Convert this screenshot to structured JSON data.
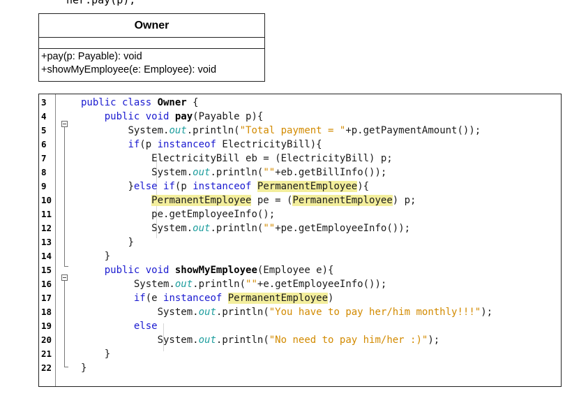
{
  "top_fragment": "ner.pay(p);",
  "uml": {
    "class_name": "Owner",
    "operations": [
      "+pay(p: Payable): void",
      "+showMyEmployee(e: Employee): void"
    ]
  },
  "code": {
    "lines": [
      {
        "num": "3",
        "indent": 2,
        "tokens": [
          {
            "t": "public class ",
            "c": "kw"
          },
          {
            "t": "Owner",
            "c": "b"
          },
          {
            "t": " {"
          }
        ]
      },
      {
        "num": "4",
        "indent": 6,
        "tokens": [
          {
            "t": "public void ",
            "c": "kw"
          },
          {
            "t": "pay",
            "c": "b"
          },
          {
            "t": "(Payable p){"
          }
        ]
      },
      {
        "num": "5",
        "indent": 10,
        "tokens": [
          {
            "t": "System."
          },
          {
            "t": "out",
            "c": "it"
          },
          {
            "t": ".println("
          },
          {
            "t": "\"Total payment = \"",
            "c": "st"
          },
          {
            "t": "+p.getPaymentAmount());"
          }
        ]
      },
      {
        "num": "6",
        "indent": 10,
        "tokens": [
          {
            "t": "if",
            "c": "kw"
          },
          {
            "t": "(p "
          },
          {
            "t": "instanceof",
            "c": "kw"
          },
          {
            "t": " ElectricityBill){"
          }
        ]
      },
      {
        "num": "7",
        "indent": 14,
        "tokens": [
          {
            "t": "ElectricityBill eb = (ElectricityBill) p;"
          }
        ]
      },
      {
        "num": "8",
        "indent": 14,
        "tokens": [
          {
            "t": "System."
          },
          {
            "t": "out",
            "c": "it"
          },
          {
            "t": ".println("
          },
          {
            "t": "\"\"",
            "c": "st"
          },
          {
            "t": "+eb.getBillInfo());"
          }
        ]
      },
      {
        "num": "9",
        "indent": 10,
        "tokens": [
          {
            "t": "}"
          },
          {
            "t": "else if",
            "c": "kw"
          },
          {
            "t": "(p "
          },
          {
            "t": "instanceof",
            "c": "kw"
          },
          {
            "t": " "
          },
          {
            "t": "PermanentEmployee",
            "c": "hl"
          },
          {
            "t": "){"
          }
        ]
      },
      {
        "num": "10",
        "indent": 14,
        "tokens": [
          {
            "t": "PermanentEmployee",
            "c": "hl"
          },
          {
            "t": " pe = ("
          },
          {
            "t": "PermanentEmployee",
            "c": "hl"
          },
          {
            "t": ") p;"
          }
        ]
      },
      {
        "num": "11",
        "indent": 14,
        "tokens": [
          {
            "t": "pe.getEmployeeInfo();"
          }
        ]
      },
      {
        "num": "12",
        "indent": 14,
        "tokens": [
          {
            "t": "System."
          },
          {
            "t": "out",
            "c": "it"
          },
          {
            "t": ".println("
          },
          {
            "t": "\"\"",
            "c": "st"
          },
          {
            "t": "+pe.getEmployeeInfo());"
          }
        ]
      },
      {
        "num": "13",
        "indent": 10,
        "tokens": [
          {
            "t": "}"
          }
        ]
      },
      {
        "num": "14",
        "indent": 6,
        "tokens": [
          {
            "t": "}"
          }
        ]
      },
      {
        "num": "15",
        "indent": 6,
        "tokens": [
          {
            "t": "public void ",
            "c": "kw"
          },
          {
            "t": "showMyEmployee",
            "c": "b"
          },
          {
            "t": "(Employee e){"
          }
        ]
      },
      {
        "num": "16",
        "indent": 11,
        "tokens": [
          {
            "t": "System."
          },
          {
            "t": "out",
            "c": "it"
          },
          {
            "t": ".println("
          },
          {
            "t": "\"\"",
            "c": "st"
          },
          {
            "t": "+e.getEmployeeInfo());"
          }
        ]
      },
      {
        "num": "17",
        "indent": 11,
        "tokens": [
          {
            "t": "if",
            "c": "kw"
          },
          {
            "t": "(e "
          },
          {
            "t": "instanceof",
            "c": "kw"
          },
          {
            "t": " "
          },
          {
            "t": "PermanentEmployee",
            "c": "hl"
          },
          {
            "t": ")"
          }
        ]
      },
      {
        "num": "18",
        "indent": 15,
        "tokens": [
          {
            "t": "System."
          },
          {
            "t": "out",
            "c": "it"
          },
          {
            "t": ".println("
          },
          {
            "t": "\"You have to pay her/him monthly!!!\"",
            "c": "st"
          },
          {
            "t": ");"
          }
        ]
      },
      {
        "num": "19",
        "indent": 11,
        "tokens": [
          {
            "t": "else",
            "c": "kw"
          }
        ]
      },
      {
        "num": "20",
        "indent": 15,
        "tokens": [
          {
            "t": "System."
          },
          {
            "t": "out",
            "c": "it"
          },
          {
            "t": ".println("
          },
          {
            "t": "\"No need to pay him/her :)\"",
            "c": "st"
          },
          {
            "t": ");"
          }
        ]
      },
      {
        "num": "21",
        "indent": 6,
        "tokens": [
          {
            "t": "}"
          }
        ]
      },
      {
        "num": "22",
        "indent": 2,
        "tokens": [
          {
            "t": "}"
          }
        ]
      }
    ]
  }
}
